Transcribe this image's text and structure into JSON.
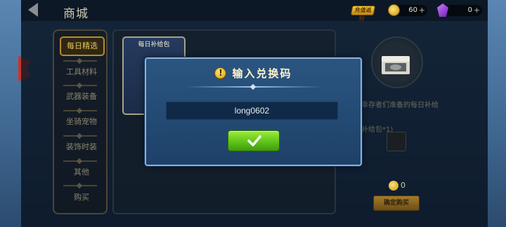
{
  "header": {
    "title": "商城",
    "vip_badge": "充值返利",
    "gold": {
      "amount": "60",
      "plus": "+",
      "icon": "gold-coin-icon"
    },
    "gem": {
      "amount": "0",
      "plus": "+",
      "icon": "purple-gem-icon"
    }
  },
  "categories": [
    {
      "label": "每日精选",
      "active": true
    },
    {
      "label": "工具材料"
    },
    {
      "label": "武器装备"
    },
    {
      "label": "坐骑宠物"
    },
    {
      "label": "装饰时装"
    },
    {
      "label": "其他"
    },
    {
      "label": "购买"
    }
  ],
  "item_card": {
    "title": "每日补给包"
  },
  "detail": {
    "description": "幸存者们准备的每日补给",
    "sub": "补给包*1)",
    "price": "0",
    "buy_label": "确定购买"
  },
  "modal": {
    "title": "输入兑换码",
    "code_value": "long0602",
    "confirm_icon": "checkmark-icon"
  },
  "colors": {
    "modal_bg": "#234a73",
    "modal_border": "#8bb1d9",
    "confirm_green": "#5fc41b",
    "active_gold": "#e9c45a"
  }
}
